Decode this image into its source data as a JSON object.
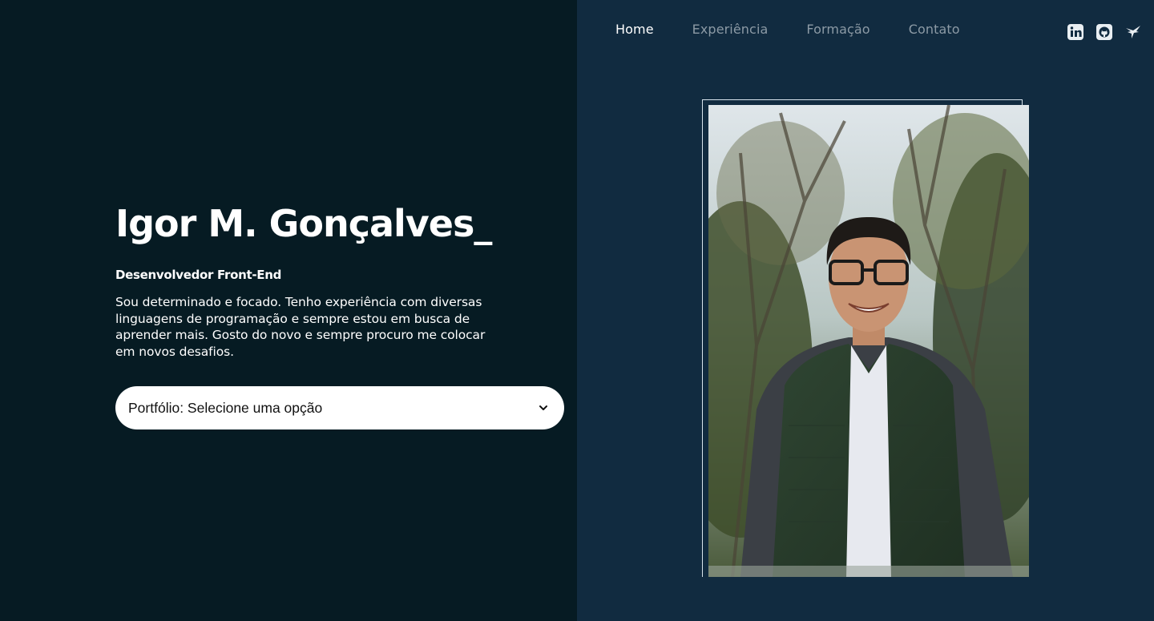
{
  "nav": {
    "items": [
      {
        "label": "Home",
        "active": true
      },
      {
        "label": "Experiência",
        "active": false
      },
      {
        "label": "Formação",
        "active": false
      },
      {
        "label": "Contato",
        "active": false
      }
    ]
  },
  "socials": [
    {
      "icon": "linkedin-icon"
    },
    {
      "icon": "github-icon"
    },
    {
      "icon": "hummingbird-icon"
    }
  ],
  "hero": {
    "name": "Igor M. Gonçalves_",
    "role": "Desenvolvedor Front-End",
    "bio": "Sou determinado e focado. Tenho experiência com diversas linguagens de programação e sempre estou em busca de aprender mais. Gosto do novo e sempre procuro me colocar em novos desafios.",
    "portfolio_select": "Portfólio: Selecione uma opção"
  },
  "colors": {
    "left_bg": "#061b23",
    "right_bg": "#112b40",
    "nav_inactive": "#8c9aa5",
    "text": "#ffffff"
  }
}
